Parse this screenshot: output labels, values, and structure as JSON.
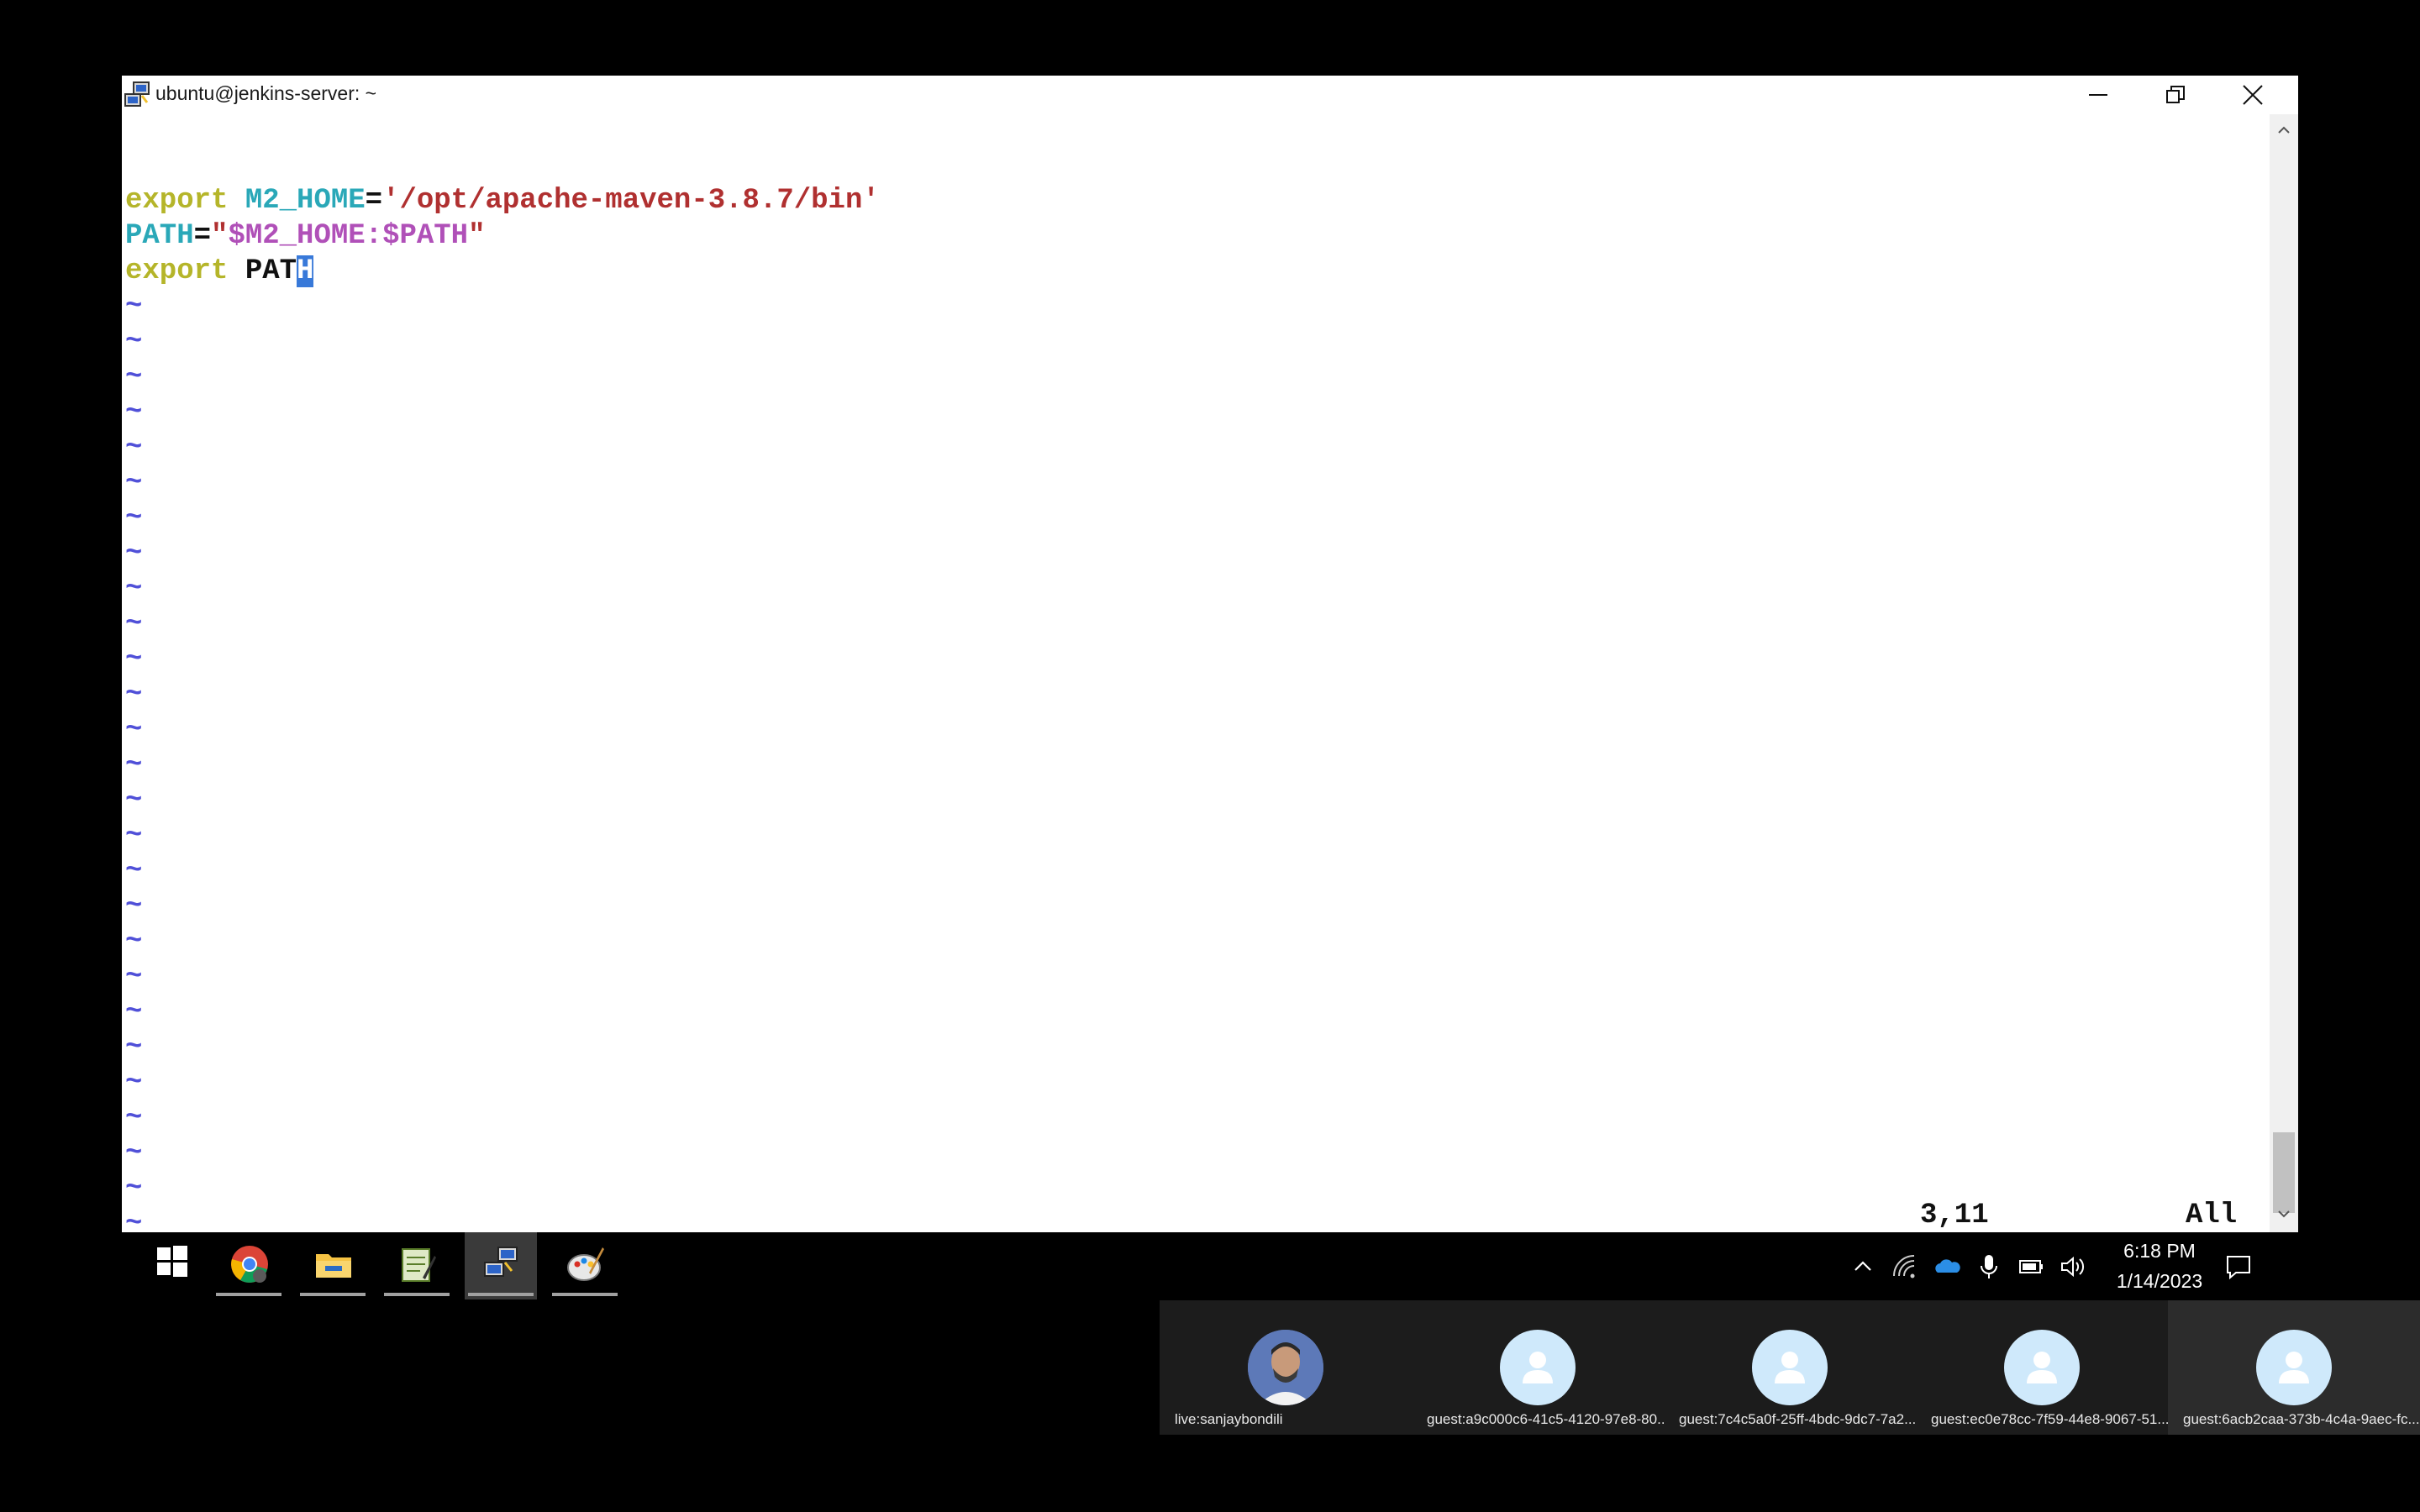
{
  "window": {
    "title": "ubuntu@jenkins-server: ~",
    "buttons": [
      "minimize",
      "restore",
      "close"
    ]
  },
  "editor": {
    "lines": [
      {
        "export": "export",
        "m2_var": "M2_HOME",
        "eq": "=",
        "value": "'/opt/apache-maven-3.8.7/bin'"
      },
      {
        "path_var": "PATH",
        "eq": "=",
        "q1": "\"",
        "value": "$M2_HOME:$PATH",
        "q2": "\""
      },
      {
        "export": "export",
        "arg_before_cursor": "PAT",
        "cursor_char": "H"
      }
    ],
    "empty_line_marker": "~",
    "empty_line_count": 27,
    "status_position": "3,11",
    "status_scroll": "All"
  },
  "taskbar": {
    "apps": [
      "start-icon",
      "chrome-icon",
      "file-explorer-icon",
      "notepad-icon",
      "remote-desktop-icon",
      "paint-icon"
    ],
    "time": "6:18 PM",
    "date": "1/14/2023"
  },
  "participants": [
    {
      "label": "live:sanjaybondili",
      "has_photo": true
    },
    {
      "label": "guest:a9c000c6-41c5-4120-97e8-80...",
      "has_photo": false
    },
    {
      "label": "guest:7c4c5a0f-25ff-4bdc-9dc7-7a2...",
      "has_photo": false
    },
    {
      "label": "guest:ec0e78cc-7f59-44e8-9067-51...",
      "has_photo": false
    },
    {
      "label": "guest:6acb2caa-373b-4c4a-9aec-fc...",
      "has_photo": false
    }
  ],
  "colors": {
    "keyword": "#b5b52a",
    "variable": "#2aa8b8",
    "string": "#b03030",
    "magenta": "#b050b8",
    "tilde": "#5050d8",
    "cursor": "#3879d9"
  }
}
